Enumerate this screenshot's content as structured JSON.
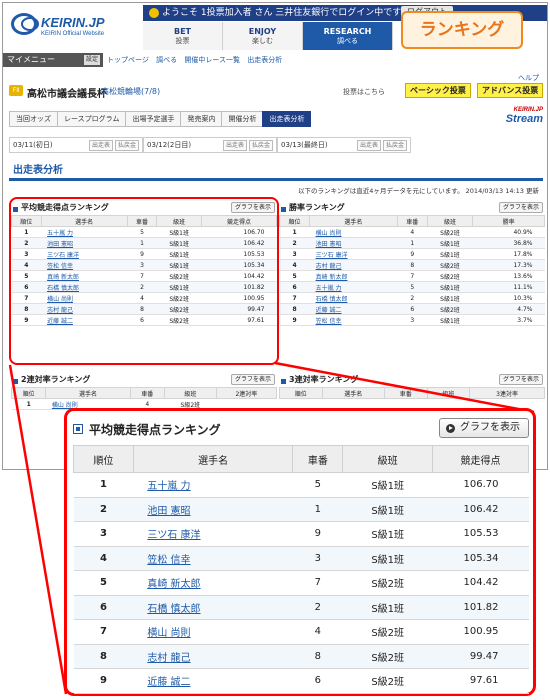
{
  "header": {
    "logo_text": "KEIRIN.JP",
    "logo_sub": "KEIRIN Official Website",
    "welcome": "ようこそ 1投票加入者 さん 三井住友銀行でログイン中です",
    "logout": "ログアウト",
    "nav": [
      {
        "en": "BET",
        "jp": "投票"
      },
      {
        "en": "ENJOY",
        "jp": "楽しむ"
      },
      {
        "en": "RESEARCH",
        "jp": "調べる"
      }
    ],
    "badge": "ランキング"
  },
  "mymenu": {
    "label": "マイメニュー",
    "settings": "設定"
  },
  "breadcrumbs": [
    "トップページ",
    "調べる",
    "開催中レース一覧",
    "出走表分析"
  ],
  "race": {
    "venue_code": "FⅡ",
    "name": "高松市議会議長杯",
    "link": "高松競輪場(7/8)",
    "help": "ヘルプ",
    "vote_info": "投票はこちら",
    "basic_vote": "ベーシック投票",
    "adv_vote": "アドバンス投票"
  },
  "subtabs": [
    "当回オッズ",
    "レースプログラム",
    "出場予定選手",
    "発売案内",
    "開催分析",
    "出走表分析"
  ],
  "stream": {
    "top": "KEIRIN.JP",
    "main": "Stream"
  },
  "dates": [
    {
      "date": "03/11(初日)",
      "btn1": "出走表",
      "btn2": "払戻金"
    },
    {
      "date": "03/12(2日目)",
      "btn1": "出走表",
      "btn2": "払戻金"
    },
    {
      "date": "03/13(最終日)",
      "btn1": "出走表",
      "btn2": "払戻金"
    }
  ],
  "section_title": "出走表分析",
  "note": "以下のランキングは直近4ヶ月データを元にしています。 2014/03/13 14:13 更新",
  "graph_button": "グラフを表示",
  "tables": {
    "avg": {
      "title": "平均競走得点ランキング",
      "headers": [
        "順位",
        "選手名",
        "車番",
        "級班",
        "競走得点"
      ],
      "rows": [
        [
          "1",
          "五十嵐 力",
          "5",
          "S級1班",
          "106.70"
        ],
        [
          "2",
          "池田 憲昭",
          "1",
          "S級1班",
          "106.42"
        ],
        [
          "3",
          "三ツ石 康洋",
          "9",
          "S級1班",
          "105.53"
        ],
        [
          "4",
          "笠松 信幸",
          "3",
          "S級1班",
          "105.34"
        ],
        [
          "5",
          "真崎 新太郎",
          "7",
          "S級2班",
          "104.42"
        ],
        [
          "6",
          "石橋 慎太郎",
          "2",
          "S級1班",
          "101.82"
        ],
        [
          "7",
          "横山 尚則",
          "4",
          "S級2班",
          "100.95"
        ],
        [
          "8",
          "志村 龍己",
          "8",
          "S級2班",
          "99.47"
        ],
        [
          "9",
          "近藤 誠二",
          "6",
          "S級2班",
          "97.61"
        ]
      ]
    },
    "win": {
      "title": "勝率ランキング",
      "headers": [
        "順位",
        "選手名",
        "車番",
        "級班",
        "勝率"
      ],
      "rows": [
        [
          "1",
          "横山 尚則",
          "4",
          "S級2班",
          "40.9%"
        ],
        [
          "2",
          "池田 憲昭",
          "1",
          "S級1班",
          "36.8%"
        ],
        [
          "3",
          "三ツ石 康洋",
          "9",
          "S級1班",
          "17.8%"
        ],
        [
          "4",
          "志村 龍己",
          "8",
          "S級2班",
          "17.3%"
        ],
        [
          "5",
          "真崎 新太郎",
          "7",
          "S級2班",
          "13.6%"
        ],
        [
          "6",
          "五十嵐 力",
          "5",
          "S級1班",
          "11.1%"
        ],
        [
          "7",
          "石橋 慎太郎",
          "2",
          "S級1班",
          "10.3%"
        ],
        [
          "8",
          "近藤 誠二",
          "6",
          "S級2班",
          "4.7%"
        ],
        [
          "9",
          "笠松 信幸",
          "3",
          "S級1班",
          "3.7%"
        ]
      ]
    },
    "rate2": {
      "title": "2連対率ランキング",
      "headers": [
        "順位",
        "選手名",
        "車番",
        "級班",
        "2連対率"
      ],
      "rows": [
        [
          "1",
          "横山 尚則",
          "4",
          "S級2班",
          ""
        ]
      ]
    },
    "rate3": {
      "title": "3連対率ランキング",
      "headers": [
        "順位",
        "選手名",
        "車番",
        "級班",
        "3連対率"
      ],
      "rows": []
    }
  },
  "colors": {
    "accent": "#1e5aa8",
    "highlight": "#ff0000",
    "badge": "#e8731a"
  }
}
